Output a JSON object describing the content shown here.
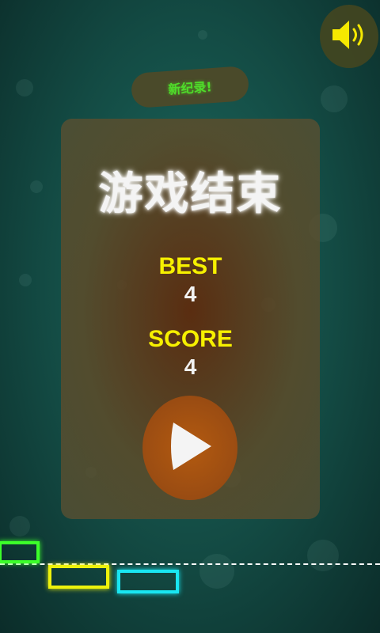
{
  "sound": {
    "icon": "speaker-on-icon",
    "color": "#f5e800"
  },
  "record_badge": {
    "text": "新纪录!"
  },
  "panel": {
    "title": "游戏结束",
    "best_label": "BEST",
    "best_value": "4",
    "score_label": "SCORE",
    "score_value": "4",
    "play_icon": "play-icon"
  },
  "blocks": [
    {
      "name": "green-block",
      "color": "#3cff2a"
    },
    {
      "name": "yellow-block",
      "color": "#eef20c"
    },
    {
      "name": "cyan-block",
      "color": "#19e6f2"
    }
  ]
}
